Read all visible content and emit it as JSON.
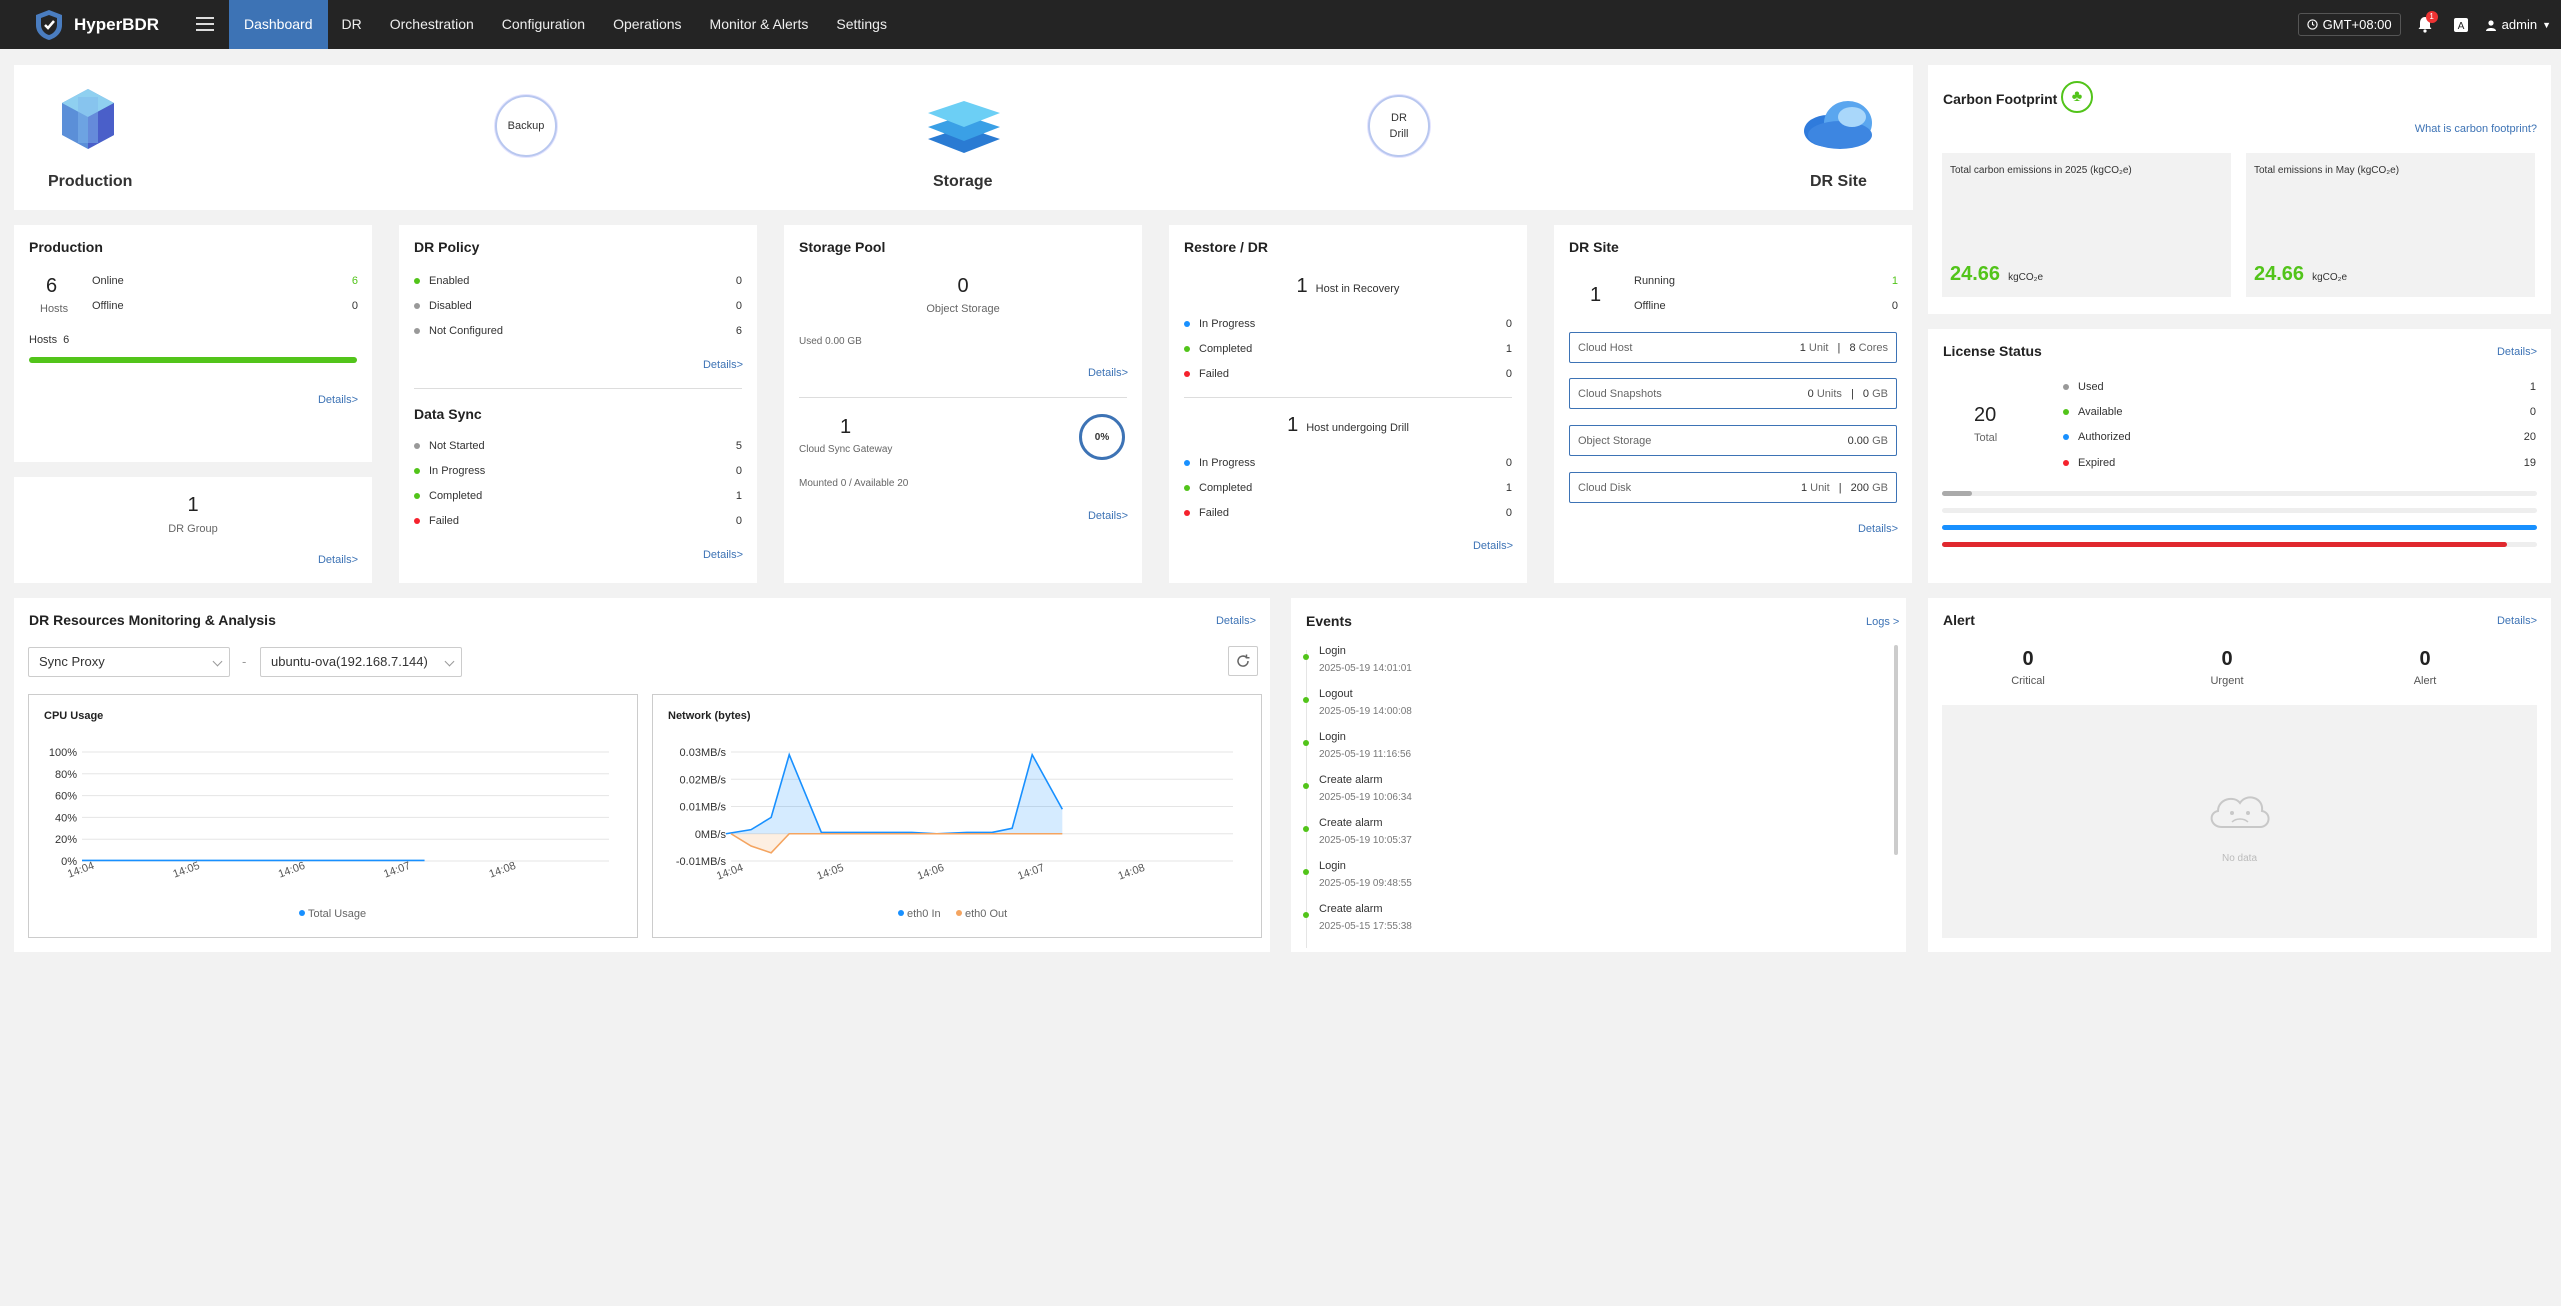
{
  "app": {
    "name": "HyperBDR"
  },
  "nav": {
    "items": [
      {
        "label": "Dashboard",
        "active": true
      },
      {
        "label": "DR"
      },
      {
        "label": "Orchestration"
      },
      {
        "label": "Configuration"
      },
      {
        "label": "Operations"
      },
      {
        "label": "Monitor & Alerts"
      },
      {
        "label": "Settings"
      }
    ]
  },
  "topbar": {
    "timezone": "GMT+08:00",
    "notification_count": "1",
    "user": "admin"
  },
  "flow": {
    "production": "Production",
    "storage": "Storage",
    "dr_site": "DR Site",
    "backup": "Backup",
    "dr_drill_1": "DR",
    "dr_drill_2": "Drill"
  },
  "production": {
    "title": "Production",
    "hosts_count": "6",
    "hosts_label": "Hosts",
    "online_label": "Online",
    "online_value": "6",
    "offline_label": "Offline",
    "offline_value": "0",
    "hosts_bar_label": "Hosts",
    "hosts_bar_value": "6",
    "hosts_online_ratio": 1.0,
    "details": "Details>"
  },
  "dr_group": {
    "count": "1",
    "label": "DR Group",
    "details": "Details>"
  },
  "dr_policy": {
    "title": "DR Policy",
    "rows": [
      {
        "label": "Enabled",
        "value": "0",
        "color": "#52c41a"
      },
      {
        "label": "Disabled",
        "value": "0",
        "color": "#999999"
      },
      {
        "label": "Not Configured",
        "value": "6",
        "color": "#999999"
      }
    ],
    "details": "Details>"
  },
  "data_sync": {
    "title": "Data Sync",
    "rows": [
      {
        "label": "Not Started",
        "value": "5",
        "color": "#999999"
      },
      {
        "label": "In Progress",
        "value": "0",
        "color": "#52c41a"
      },
      {
        "label": "Completed",
        "value": "1",
        "color": "#52c41a"
      },
      {
        "label": "Failed",
        "value": "0",
        "color": "#f5222d"
      }
    ],
    "details": "Details>"
  },
  "storage_pool": {
    "title": "Storage Pool",
    "object_storage_count": "0",
    "object_storage_label": "Object Storage",
    "used": "Used 0.00 GB",
    "details_1": "Details>",
    "gateway_count": "1",
    "gateway_label": "Cloud Sync Gateway",
    "gateway_percent": "0%",
    "mounted": "Mounted 0 / Available 20",
    "details_2": "Details>"
  },
  "restore_dr": {
    "title": "Restore / DR",
    "recovery_count": "1",
    "recovery_label": "Host in Recovery",
    "recovery_rows": [
      {
        "label": "In Progress",
        "value": "0",
        "color": "#1890ff"
      },
      {
        "label": "Completed",
        "value": "1",
        "color": "#52c41a"
      },
      {
        "label": "Failed",
        "value": "0",
        "color": "#f5222d"
      }
    ],
    "drill_count": "1",
    "drill_label": "Host undergoing Drill",
    "drill_rows": [
      {
        "label": "In Progress",
        "value": "0",
        "color": "#1890ff"
      },
      {
        "label": "Completed",
        "value": "1",
        "color": "#52c41a"
      },
      {
        "label": "Failed",
        "value": "0",
        "color": "#f5222d"
      }
    ],
    "details": "Details>"
  },
  "dr_site": {
    "title": "DR Site",
    "count": "1",
    "running_label": "Running",
    "running_value": "1",
    "offline_label": "Offline",
    "offline_value": "0",
    "boxes": [
      {
        "label": "Cloud Host",
        "v1": "1",
        "u1": "Unit",
        "v2": "8",
        "u2": "Cores"
      },
      {
        "label": "Cloud Snapshots",
        "v1": "0",
        "u1": "Units",
        "v2": "0",
        "u2": "GB"
      },
      {
        "label": "Object Storage",
        "v1": "",
        "u1": "",
        "v2": "0.00",
        "u2": "GB"
      },
      {
        "label": "Cloud Disk",
        "v1": "1",
        "u1": "Unit",
        "v2": "200",
        "u2": "GB"
      }
    ],
    "details": "Details>"
  },
  "carbon": {
    "title": "Carbon Footprint",
    "link": "What is carbon footprint?",
    "year_label": "Total carbon emissions in 2025 (kgCO₂e)",
    "year_value": "24.66",
    "year_unit": "kgCO₂e",
    "month_label": "Total emissions in May (kgCO₂e)",
    "month_value": "24.66",
    "month_unit": "kgCO₂e"
  },
  "license": {
    "title": "License Status",
    "details": "Details>",
    "total": "20",
    "total_label": "Total",
    "rows": [
      {
        "label": "Used",
        "value": "1",
        "color": "#999999"
      },
      {
        "label": "Available",
        "value": "0",
        "color": "#52c41a"
      },
      {
        "label": "Authorized",
        "value": "20",
        "color": "#1890ff"
      },
      {
        "label": "Expired",
        "value": "19",
        "color": "#f5222d"
      }
    ],
    "bars": [
      {
        "fraction": 0.05,
        "color": "#aaaaaa"
      },
      {
        "fraction": 0.0,
        "color": "#52c41a"
      },
      {
        "fraction": 1.0,
        "color": "#1890ff"
      },
      {
        "fraction": 0.95,
        "color": "#e0282e"
      }
    ]
  },
  "monitoring": {
    "title": "DR Resources Monitoring & Analysis",
    "details": "Details>",
    "select_type": "Sync Proxy",
    "separator": "-",
    "select_host": "ubuntu-ova(192.168.7.144)"
  },
  "events": {
    "title": "Events",
    "logs": "Logs >",
    "items": [
      {
        "name": "Login",
        "time": "2025-05-19 14:01:01"
      },
      {
        "name": "Logout",
        "time": "2025-05-19 14:00:08"
      },
      {
        "name": "Login",
        "time": "2025-05-19 11:16:56"
      },
      {
        "name": "Create alarm",
        "time": "2025-05-19 10:06:34"
      },
      {
        "name": "Create alarm",
        "time": "2025-05-19 10:05:37"
      },
      {
        "name": "Login",
        "time": "2025-05-19 09:48:55"
      },
      {
        "name": "Create alarm",
        "time": "2025-05-15 17:55:38"
      }
    ]
  },
  "alert": {
    "title": "Alert",
    "details": "Details>",
    "critical_value": "0",
    "critical_label": "Critical",
    "urgent_value": "0",
    "urgent_label": "Urgent",
    "alert_value": "0",
    "alert_label": "Alert",
    "no_data": "No data"
  },
  "chart_data": [
    {
      "type": "line",
      "title": "CPU Usage",
      "categories": [
        "14:04",
        "14:05",
        "14:06",
        "14:07",
        "14:08"
      ],
      "y_ticks": [
        "100%",
        "80%",
        "60%",
        "40%",
        "20%",
        "0%"
      ],
      "ylim": [
        0,
        100
      ],
      "series": [
        {
          "name": "Total Usage",
          "color": "#1890ff",
          "x": [
            0,
            0.25,
            0.5,
            0.75,
            1.0,
            1.25,
            1.5,
            1.75,
            2.0,
            2.25,
            2.5,
            2.75,
            3.0,
            3.25
          ],
          "values": [
            0.5,
            0.5,
            0.5,
            0.5,
            0.5,
            0.5,
            0.5,
            0.5,
            0.5,
            0.5,
            0.5,
            0.5,
            0.5,
            0.5
          ]
        }
      ]
    },
    {
      "type": "area",
      "title": "Network (bytes)",
      "categories": [
        "14:04",
        "14:05",
        "14:06",
        "14:07",
        "14:08"
      ],
      "y_ticks": [
        "0.03MB/s",
        "0.02MB/s",
        "0.01MB/s",
        "0MB/s",
        "-0.01MB/s"
      ],
      "ylim": [
        -0.01,
        0.03
      ],
      "series": [
        {
          "name": "eth0 In",
          "color": "#1890ff",
          "x": [
            -0.05,
            0.2,
            0.4,
            0.58,
            0.9,
            1.2,
            1.5,
            1.8,
            2.05,
            2.35,
            2.6,
            2.8,
            3.0,
            3.3
          ],
          "values": [
            0.0,
            0.0015,
            0.006,
            0.029,
            0.0005,
            0.0005,
            0.0005,
            0.0005,
            0.0,
            0.0005,
            0.0005,
            0.002,
            0.029,
            0.009
          ]
        },
        {
          "name": "eth0 Out",
          "color": "#f4a460",
          "x": [
            0,
            0.2,
            0.4,
            0.58,
            0.9,
            1.2,
            1.5,
            1.8,
            2.05,
            2.35,
            2.6,
            2.8,
            3.0,
            3.3
          ],
          "values": [
            0.0,
            -0.0045,
            -0.007,
            0.0,
            0.0,
            0.0,
            0.0,
            0.0,
            0.0,
            0.0,
            0.0,
            0.0,
            0.0,
            0.0
          ]
        }
      ]
    }
  ]
}
